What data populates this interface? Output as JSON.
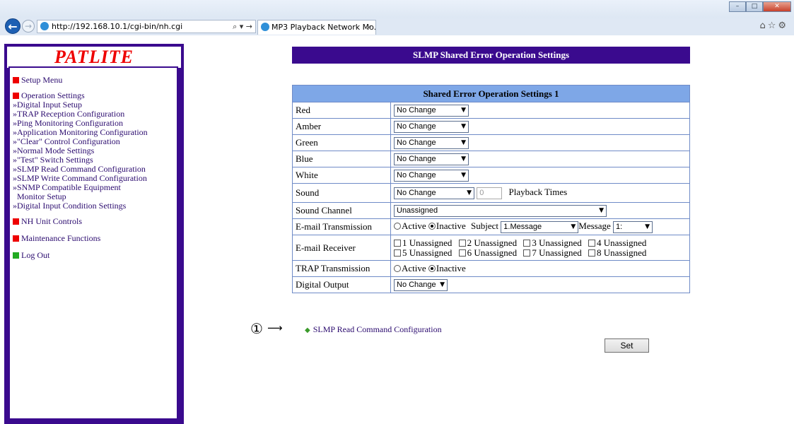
{
  "browser": {
    "url": "http://192.168.10.1/cgi-bin/nh.cgi",
    "address_controls": "⌕ ▾ →",
    "tab_title": "MP3 Playback Network Mo...",
    "tab_close": "×",
    "win_min": "–",
    "win_max": "□",
    "win_close": "✕",
    "fav_icons": "⌂☆⚙"
  },
  "sidebar": {
    "logo": "PATLITE",
    "setup_menu": "Setup Menu",
    "operation_settings": "Operation Settings",
    "items": [
      "»Digital Input Setup",
      "»TRAP Reception Configuration",
      "»Ping Monitoring Configuration",
      "»Application Monitoring Configuration",
      "»\"Clear\" Control Configuration",
      "»Normal Mode Settings",
      "»\"Test\" Switch Settings",
      "»SLMP Read Command Configuration",
      "»SLMP Write Command Configuration",
      "»SNMP Compatible Equipment",
      "Monitor Setup",
      "»Digital Input Condition Settings"
    ],
    "nh_unit_controls": "NH Unit Controls",
    "maintenance": "Maintenance Functions",
    "logout": "Log Out"
  },
  "main": {
    "page_title": "SLMP Shared Error Operation Settings",
    "table_title": "Shared Error Operation Settings 1",
    "rows": {
      "red": {
        "label": "Red",
        "value": "No Change"
      },
      "amber": {
        "label": "Amber",
        "value": "No Change"
      },
      "green": {
        "label": "Green",
        "value": "No Change"
      },
      "blue": {
        "label": "Blue",
        "value": "No Change"
      },
      "white": {
        "label": "White",
        "value": "No Change"
      },
      "sound": {
        "label": "Sound",
        "value": "No Change",
        "times_placeholder": "0",
        "times_label": "Playback Times"
      },
      "sound_channel": {
        "label": "Sound Channel",
        "value": "Unassigned"
      },
      "email_tx": {
        "label": "E-mail Transmission",
        "active": "Active",
        "inactive": "Inactive",
        "subject_label": "Subject",
        "subject_value": "1.Message",
        "message_label": "Message",
        "message_value": "1:"
      },
      "email_rx": {
        "label": "E-mail Receiver",
        "recipients": [
          "1 Unassigned",
          "2 Unassigned",
          "3 Unassigned",
          "4 Unassigned",
          "5 Unassigned",
          "6 Unassigned",
          "7 Unassigned",
          "8 Unassigned"
        ]
      },
      "trap_tx": {
        "label": "TRAP Transmission",
        "active": "Active",
        "inactive": "Inactive"
      },
      "digital_output": {
        "label": "Digital Output",
        "value": "No Change"
      }
    },
    "annotation_number": "①",
    "annotation_arrow": "⟶",
    "back_link": "SLMP Read Command Configuration",
    "set_button": "Set"
  }
}
